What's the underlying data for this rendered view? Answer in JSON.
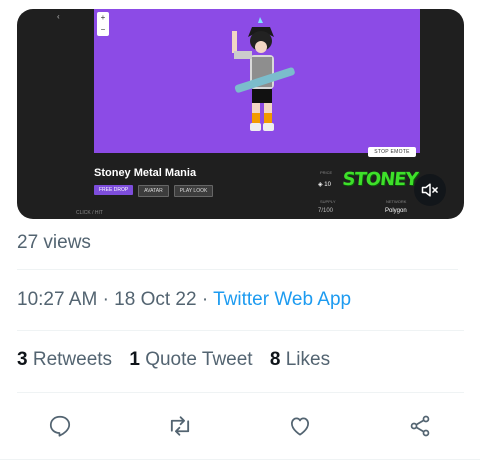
{
  "media": {
    "nft_name": "Stoney Metal Mania",
    "badges": [
      "FREE DROP",
      "AVATAR",
      "PLAY LOOK"
    ],
    "stop_button": "STOP EMOTE",
    "footer_left": "CLICK / HIT",
    "info": {
      "price_label": "PRICE",
      "price_value": "10",
      "supply_label": "SUPPLY",
      "supply_value": "7/100",
      "network_label": "NETWORK",
      "network_value": "Polygon"
    },
    "logo_text": "STONEY"
  },
  "tweet": {
    "views": "27 views",
    "time": "10:27 AM",
    "date": "18 Oct 22",
    "separator": "·",
    "source_app": "Twitter Web App",
    "retweets_count": "3",
    "retweets_label": "Retweets",
    "quotes_count": "1",
    "quotes_label": "Quote Tweet",
    "likes_count": "8",
    "likes_label": "Likes"
  },
  "icons": {
    "reply": "reply-icon",
    "retweet": "retweet-icon",
    "like": "like-icon",
    "share": "share-icon",
    "mute": "volume-muted-icon"
  },
  "colors": {
    "link": "#1d9bf0",
    "secondary_text": "#536471",
    "scene_purple": "#8c4be6",
    "logo_green": "#3ee02a"
  }
}
